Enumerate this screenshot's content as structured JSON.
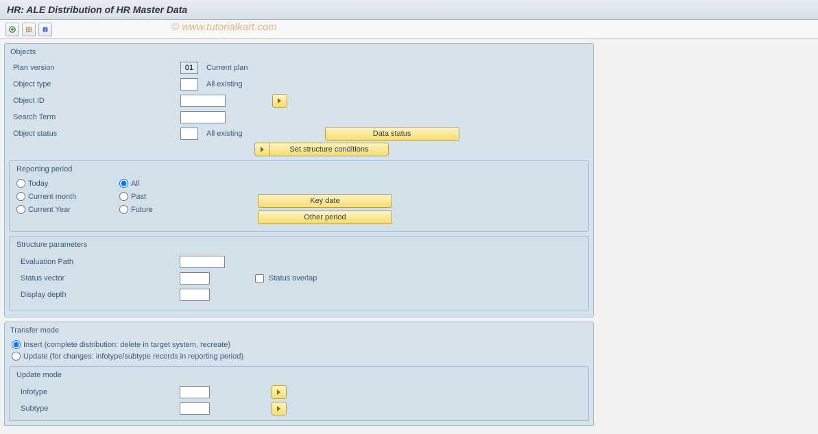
{
  "title": "HR: ALE Distribution of HR Master Data",
  "watermark": "© www.tutorialkart.com",
  "objects": {
    "group_label": "Objects",
    "plan_version_label": "Plan version",
    "plan_version_value": "01",
    "plan_version_desc": "Current plan",
    "object_type_label": "Object type",
    "object_type_value": "",
    "object_type_desc": "All existing",
    "object_id_label": "Object ID",
    "object_id_value": "",
    "search_term_label": "Search Term",
    "search_term_value": "",
    "object_status_label": "Object status",
    "object_status_value": "",
    "object_status_desc": "All existing",
    "data_status_btn": "Data status",
    "structure_conditions_btn": "Set structure conditions"
  },
  "reporting": {
    "group_label": "Reporting period",
    "today": "Today",
    "current_month": "Current month",
    "current_year": "Current Year",
    "all": "All",
    "past": "Past",
    "future": "Future",
    "key_date_btn": "Key date",
    "other_period_btn": "Other period",
    "selected": "All"
  },
  "structure": {
    "group_label": "Structure parameters",
    "eval_path_label": "Evaluation Path",
    "eval_path_value": "",
    "status_vector_label": "Status vector",
    "status_vector_value": "",
    "status_overlap_label": "Status overlap",
    "display_depth_label": "Display depth",
    "display_depth_value": ""
  },
  "transfer": {
    "group_label": "Transfer mode",
    "insert_label": "Insert (complete distribution: delete in target system, recreate)",
    "update_label": "Update (for changes: infotype/subtype records in reporting period)",
    "selected": "Insert"
  },
  "update_mode": {
    "group_label": "Update mode",
    "infotype_label": "Infotype",
    "infotype_value": "",
    "subtype_label": "Subtype",
    "subtype_value": ""
  }
}
